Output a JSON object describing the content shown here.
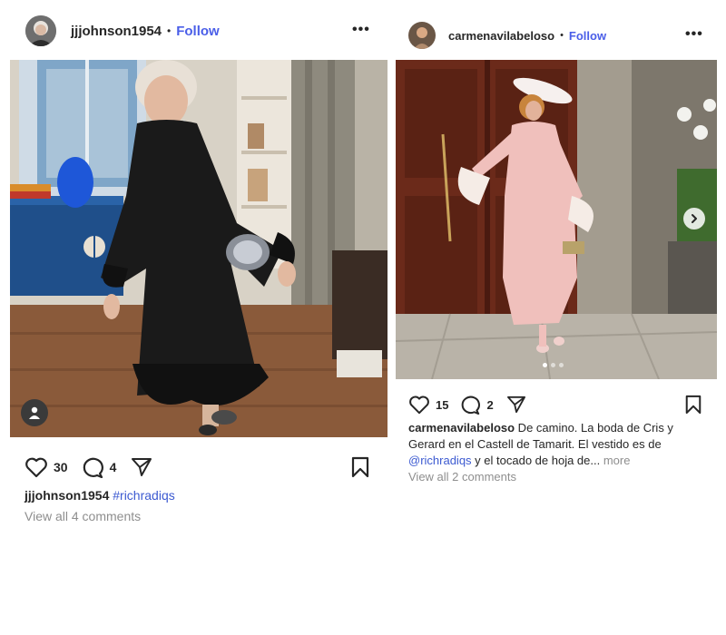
{
  "posts": [
    {
      "username": "jjjohnson1954",
      "separator": "•",
      "follow_label": "Follow",
      "more_glyph": "•••",
      "likes": "30",
      "comments_count": "4",
      "caption_user": "jjjohnson1954",
      "caption_tag": "#richradiqs",
      "view_comments": "View all 4 comments",
      "photo_description": "black-feather-trim-dress-photo"
    },
    {
      "username": "carmenavilabeloso",
      "separator": "•",
      "follow_label": "Follow",
      "more_glyph": "•••",
      "likes": "15",
      "comments_count": "2",
      "caption_user": "carmenavilabeloso",
      "caption_text_1": " De camino. La boda de Cris y Gerard en el Castell de Tamarit. El vestido es de ",
      "caption_tag": "@richradiqs",
      "caption_text_2": " y el tocado de hoja de...",
      "caption_more": " more",
      "view_comments": "View all 2 comments",
      "carousel_dots": 3
    }
  ],
  "colors": {
    "link_blue": "#4a5ee8",
    "text": "#262626",
    "muted": "#8e8e8e"
  }
}
